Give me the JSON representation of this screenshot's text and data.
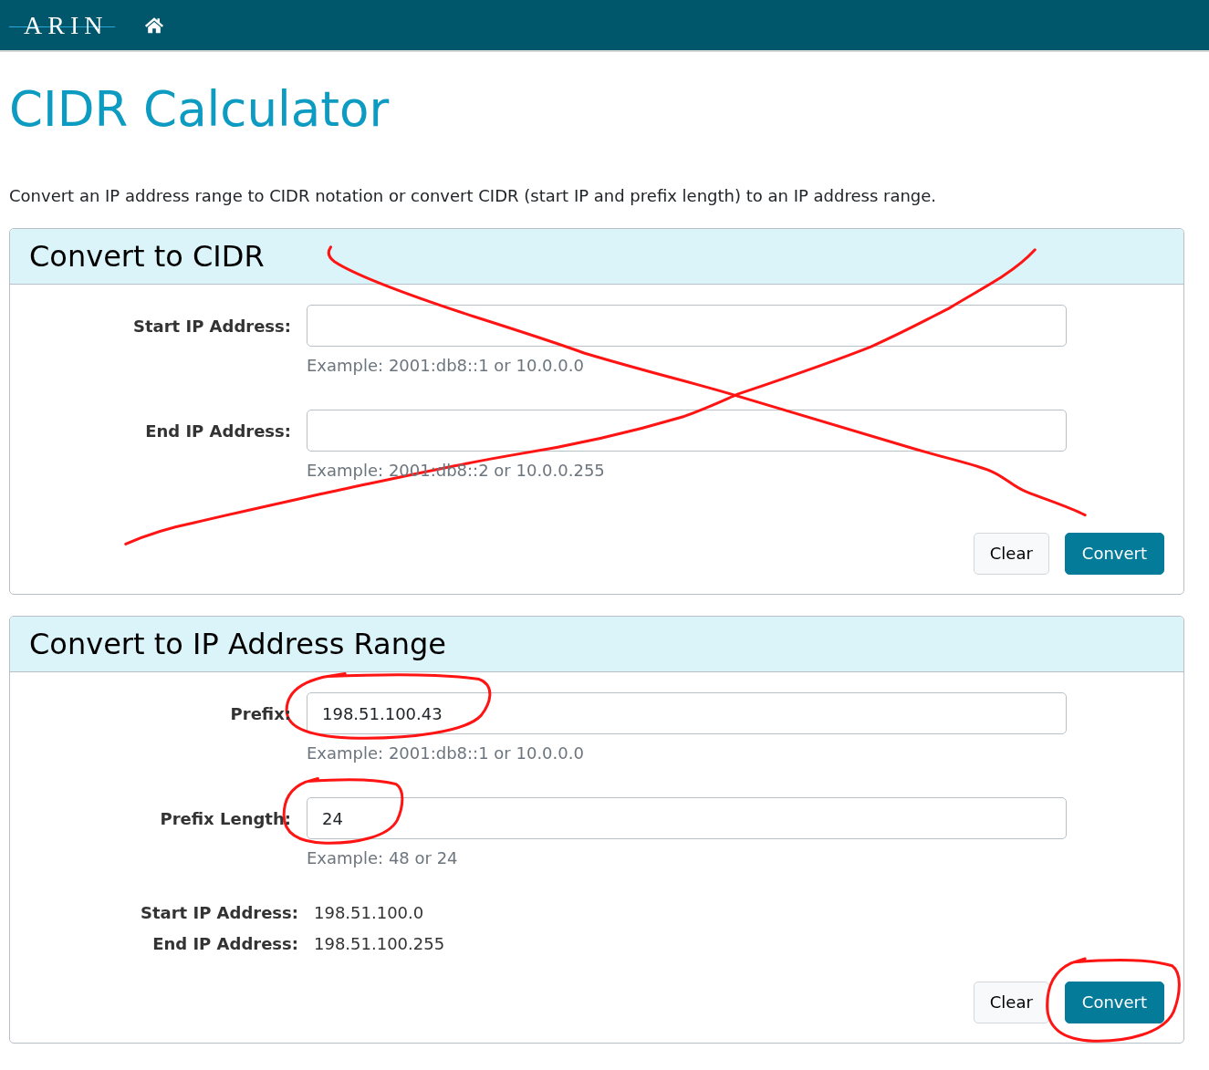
{
  "header": {
    "logo": "ARIN"
  },
  "page": {
    "title": "CIDR Calculator",
    "description": "Convert an IP address range to CIDR notation or convert CIDR (start IP and prefix length) to an IP address range."
  },
  "sections": [
    {
      "title": "Convert to CIDR",
      "crossed_out": true,
      "fields": [
        {
          "label": "Start IP Address:",
          "hint": "Example: 2001:db8::1 or 10.0.0.0",
          "circled": false
        },
        {
          "label": "End IP Address:",
          "hint": "Example: 2001:db8::2 or 10.0.0.255",
          "circled": false
        }
      ],
      "buttons": [
        {
          "label": "Clear",
          "kind": "secondary",
          "circled": false
        },
        {
          "label": "Convert",
          "kind": "primary",
          "circled": false
        }
      ]
    },
    {
      "title": "Convert to IP Address Range",
      "crossed_out": false,
      "fields": [
        {
          "label": "Prefix:",
          "value": "198.51.100.43",
          "hint": "Example: 2001:db8::1 or 10.0.0.0",
          "circled": true
        },
        {
          "label": "Prefix Length:",
          "value": "24",
          "hint": "Example: 48 or 24",
          "circled": true
        }
      ],
      "results": [
        {
          "label": "Start IP Address:",
          "value": "198.51.100.0"
        },
        {
          "label": "End IP Address:",
          "value": "198.51.100.255"
        }
      ],
      "buttons": [
        {
          "label": "Clear",
          "kind": "secondary",
          "circled": false
        },
        {
          "label": "Convert",
          "kind": "primary",
          "circled": true
        }
      ]
    }
  ]
}
